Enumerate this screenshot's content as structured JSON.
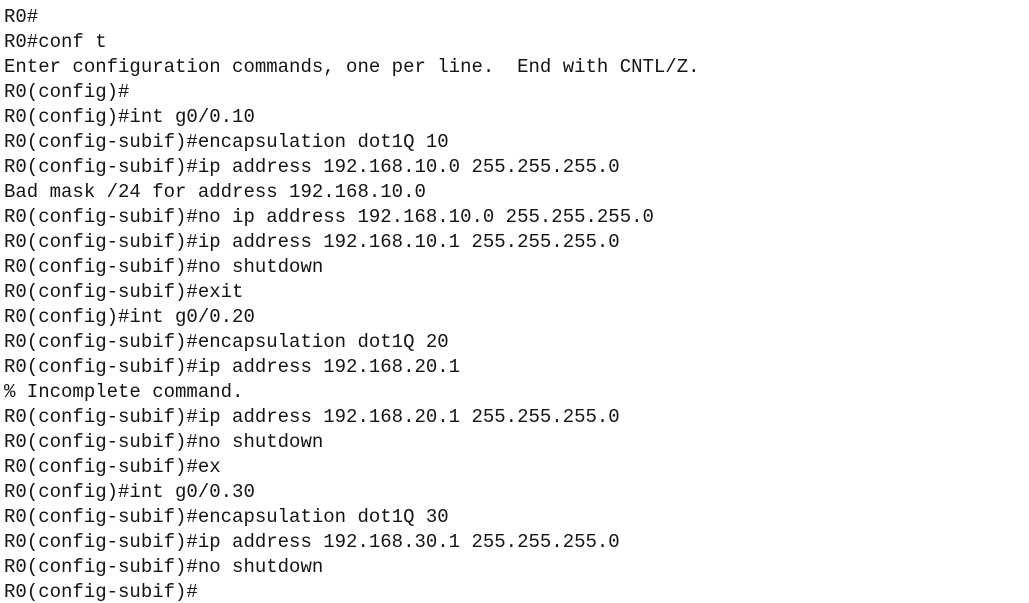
{
  "terminal": {
    "text_color": "#141414",
    "background": "#ffffff",
    "lines": [
      "R0#",
      "R0#conf t",
      "Enter configuration commands, one per line.  End with CNTL/Z.",
      "R0(config)#",
      "R0(config)#int g0/0.10",
      "R0(config-subif)#encapsulation dot1Q 10",
      "R0(config-subif)#ip address 192.168.10.0 255.255.255.0",
      "Bad mask /24 for address 192.168.10.0",
      "R0(config-subif)#no ip address 192.168.10.0 255.255.255.0",
      "R0(config-subif)#ip address 192.168.10.1 255.255.255.0",
      "R0(config-subif)#no shutdown",
      "R0(config-subif)#exit",
      "R0(config)#int g0/0.20",
      "R0(config-subif)#encapsulation dot1Q 20",
      "R0(config-subif)#ip address 192.168.20.1",
      "% Incomplete command.",
      "R0(config-subif)#ip address 192.168.20.1 255.255.255.0",
      "R0(config-subif)#no shutdown",
      "R0(config-subif)#ex",
      "R0(config)#int g0/0.30",
      "R0(config-subif)#encapsulation dot1Q 30",
      "R0(config-subif)#ip address 192.168.30.1 255.255.255.0",
      "R0(config-subif)#no shutdown",
      "R0(config-subif)#"
    ]
  }
}
